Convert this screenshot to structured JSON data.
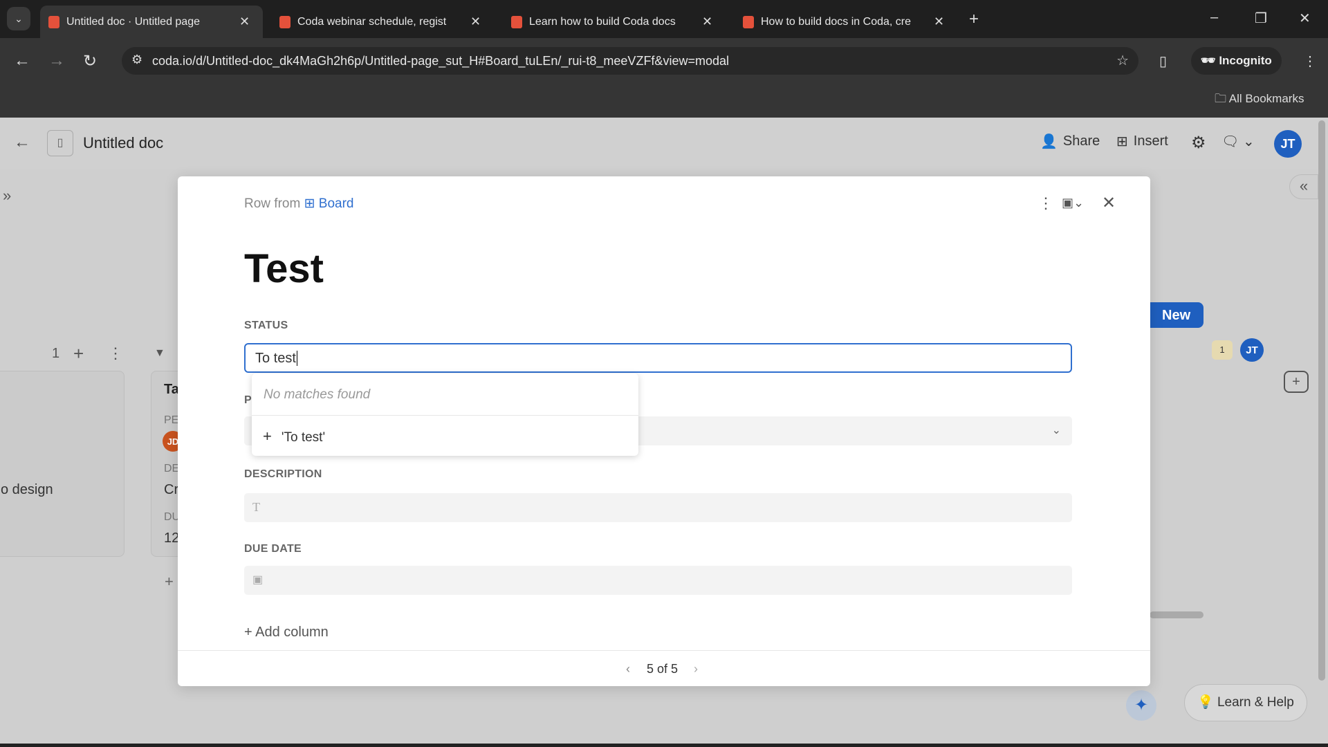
{
  "browser": {
    "tabs": [
      {
        "title": "Untitled doc · Untitled page",
        "active": true
      },
      {
        "title": "Coda webinar schedule, regist"
      },
      {
        "title": "Learn how to build Coda docs"
      },
      {
        "title": "How to build docs in Coda, cre"
      }
    ],
    "url": "coda.io/d/Untitled-doc_dk4MaGh2h6p/Untitled-page_sut_H#Board_tuLEn/_rui-t8_meeVZFf&view=modal",
    "incognito": "Incognito",
    "bookmarks": "All Bookmarks"
  },
  "app": {
    "doc_title": "Untitled doc",
    "share": "Share",
    "insert": "Insert",
    "user_initials": "JT",
    "new_button": "New",
    "comment_count": "1",
    "learn_help": "Learn & Help",
    "accent": "#1f5fbf"
  },
  "board": {
    "count": "1",
    "card1_text": "o design",
    "card2": {
      "title": "Ta",
      "l1": "PE",
      "avatar": "JD",
      "l2": "DE",
      "v2": "Cr",
      "l3": "DU",
      "v3": "12"
    }
  },
  "modal": {
    "row_from": "Row from",
    "table_name": "Board",
    "title": "Test",
    "status_label": "STATUS",
    "status_value": "To test",
    "no_matches": "No matches found",
    "add_option": "'To test'",
    "person_label": "P",
    "description_label": "DESCRIPTION",
    "due_date_label": "DUE DATE",
    "add_column": "Add column",
    "pager": "5 of 5"
  }
}
